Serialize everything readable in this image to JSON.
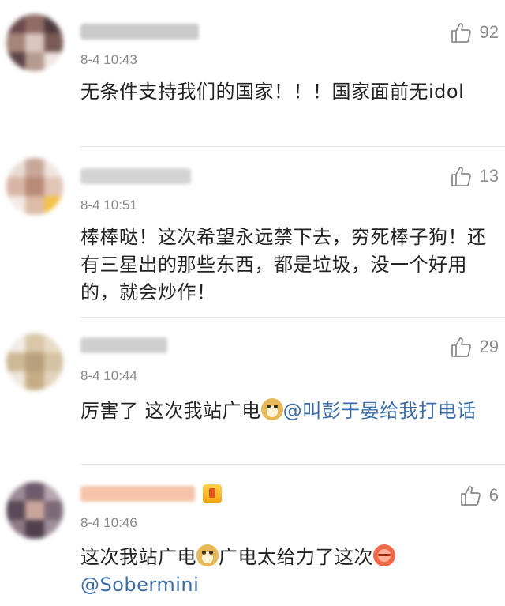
{
  "comments": [
    {
      "likes": "92",
      "time": "8-4 10:43",
      "text": "无条件支持我们的国家！！！国家面前无idol",
      "avatar_colors": [
        "#6b4a4f",
        "#8f6b64",
        "#4f3a3c",
        "#a68579",
        "#d9c6bf",
        "#7a5b56",
        "#5c4447",
        "#b59a90",
        "#efe6e2"
      ],
      "name_color": "#c9c9c9"
    },
    {
      "likes": "13",
      "time": "8-4 10:51",
      "text": "棒棒哒！这次希望永远禁下去，穷死棒子狗！还有三星出的那些东西，都是垃圾，没一个好用的，就会炒作！",
      "avatar_colors": [
        "#e9dcd5",
        "#c9a89a",
        "#f1e7e1",
        "#d8b6a6",
        "#b98a77",
        "#e2c6b8",
        "#f3eae5",
        "#dcbca9",
        "#f3c14a"
      ],
      "name_color": "#d3d3d3"
    },
    {
      "likes": "29",
      "time": "8-4 10:44",
      "text_before": "厉害了 这次我站广电",
      "emoji": "doge-emoji",
      "mention": "@叫彭于晏给我打电话",
      "avatar_colors": [
        "#f2ede6",
        "#d9c7a8",
        "#e8dcc6",
        "#cdb795",
        "#b8a07c",
        "#d6c3a5",
        "#efe8dd",
        "#c6ad86",
        "#e3d5bd"
      ],
      "name_color": "#cfcfcf"
    },
    {
      "likes": "6",
      "time": "8-4 10:46",
      "text_before": "这次我站广电",
      "emoji": "doge-emoji",
      "text_after": "广电太给力了这次",
      "emoji2": "cry-emoji",
      "mention": "@Sobermini",
      "avatar_colors": [
        "#9b8a98",
        "#6e5b6b",
        "#b6a5b0",
        "#5a4a57",
        "#caa59c",
        "#7d6a79",
        "#8e7a86",
        "#4f3f4c",
        "#a08f9b"
      ],
      "name_color": "#f6c3a8"
    }
  ],
  "icons": {
    "like": "thumbs-up-icon"
  }
}
